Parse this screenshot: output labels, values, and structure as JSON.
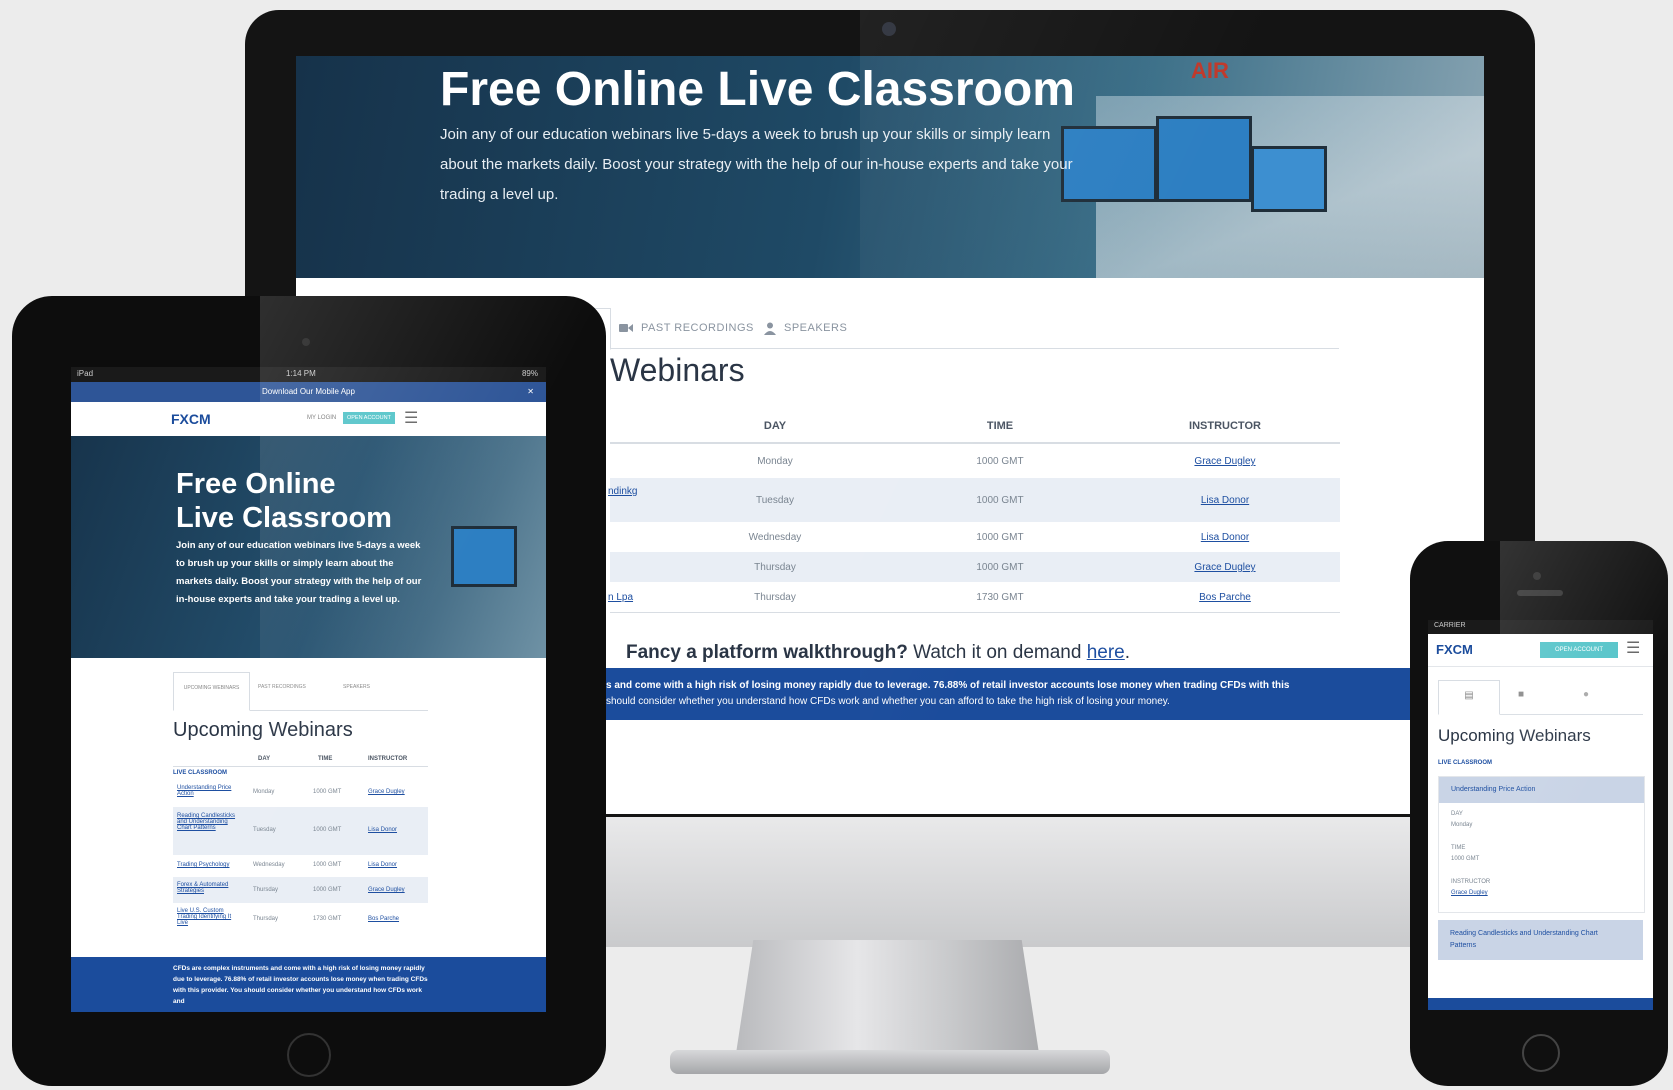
{
  "desktop": {
    "hero_title": "Free Online Live Classroom",
    "hero_description": "Join any of our education webinars live 5-days a week to brush up your skills or simply learn about the markets daily. Boost your strategy with the help of our in-house experts and take your trading a level up.",
    "tabs": [
      {
        "label": "PAST RECORDINGS",
        "icon": "video-camera-icon"
      },
      {
        "label": "SPEAKERS",
        "icon": "person-icon"
      }
    ],
    "webinars_heading": "Webinars",
    "table_headers": {
      "day": "DAY",
      "time": "TIME",
      "instructor": "INSTRUCTOR"
    },
    "rows": [
      {
        "title": "",
        "day": "Monday",
        "time": "1000 GMT",
        "instructor": "Grace Dugley"
      },
      {
        "title": "ndinkg",
        "day": "Tuesday",
        "time": "1000 GMT",
        "instructor": "Lisa Donor"
      },
      {
        "title": "",
        "day": "Wednesday",
        "time": "1000 GMT",
        "instructor": "Lisa Donor"
      },
      {
        "title": "",
        "day": "Thursday",
        "time": "1000 GMT",
        "instructor": "Grace Dugley"
      },
      {
        "title": "n Lpa",
        "day": "Thursday",
        "time": "1730 GMT",
        "instructor": "Bos Parche"
      }
    ],
    "walkthrough_bold": "Fancy a platform walkthrough?",
    "walkthrough_text": " Watch it on demand ",
    "walkthrough_link": "here",
    "walkthrough_end": ".",
    "risk_line1": "s and come with a high risk of losing money rapidly due to leverage. 76.88% of retail investor accounts lose money when trading CFDs with this",
    "risk_line2": "should consider whether you understand how CFDs work and whether you can afford to take the high risk of losing your money.",
    "studio_sign": "AIR"
  },
  "tablet": {
    "status_left": "iPad",
    "status_center": "1:14 PM",
    "status_right": "89%",
    "download_bar": "Download Our Mobile App",
    "close_label": "✕",
    "logo": "FXCM",
    "nav_login": "MY LOGIN",
    "nav_button": "OPEN ACCOUNT",
    "hero_title_line1": "Free Online",
    "hero_title_line2": "Live Classroom",
    "hero_description": "Join any of our education webinars live 5-days a week to brush up your skills or simply learn about the markets daily. Boost your strategy with the help of our in-house experts and take your trading a level up.",
    "tabs": [
      "UPCOMING WEBINARS",
      "PAST RECORDINGS",
      "SPEAKERS"
    ],
    "heading": "Upcoming Webinars",
    "table_headers": [
      "DAY",
      "TIME",
      "INSTRUCTOR"
    ],
    "section_label": "LIVE CLASSROOM",
    "rows": [
      {
        "title": "Understanding Price Action",
        "day": "Monday",
        "time": "1000 GMT",
        "instructor": "Grace Dugley"
      },
      {
        "title": "Reading Candlesticks and Understanding Chart Patterns",
        "day": "Tuesday",
        "time": "1000 GMT",
        "instructor": "Lisa Donor"
      },
      {
        "title": "Trading Psychology",
        "day": "Wednesday",
        "time": "1000 GMT",
        "instructor": "Lisa Donor"
      },
      {
        "title": "Forex & Automated Strategies",
        "day": "Thursday",
        "time": "1000 GMT",
        "instructor": "Grace Dugley"
      },
      {
        "title": "Live U.S. Custom Trading Identifying It Live",
        "day": "Thursday",
        "time": "1730 GMT",
        "instructor": "Bos Parche"
      }
    ],
    "risk_text": "CFDs are complex instruments and come with a high risk of losing money rapidly due to leverage. 76.88% of retail investor accounts lose money when trading CFDs with this provider. You should consider whether you understand how CFDs work and"
  },
  "phone": {
    "status_left": "CARRIER",
    "logo": "FXCM",
    "nav_button": "OPEN ACCOUNT",
    "heading": "Upcoming Webinars",
    "section_label": "LIVE CLASSROOM",
    "card1_title": "Understanding Price Action",
    "card1_day_label": "DAY",
    "card1_day": "Monday",
    "card1_time_label": "TIME",
    "card1_time": "1000 GMT",
    "card1_instructor_label": "INSTRUCTOR",
    "card1_instructor": "Grace Dugley",
    "card2_title": "Reading Candlesticks and Understanding Chart Patterns"
  },
  "colors": {
    "brand_blue": "#1b4c9c",
    "link_blue": "#1e4fa1",
    "hero_dark": "#17344c",
    "accent_teal": "#55c4c9"
  }
}
